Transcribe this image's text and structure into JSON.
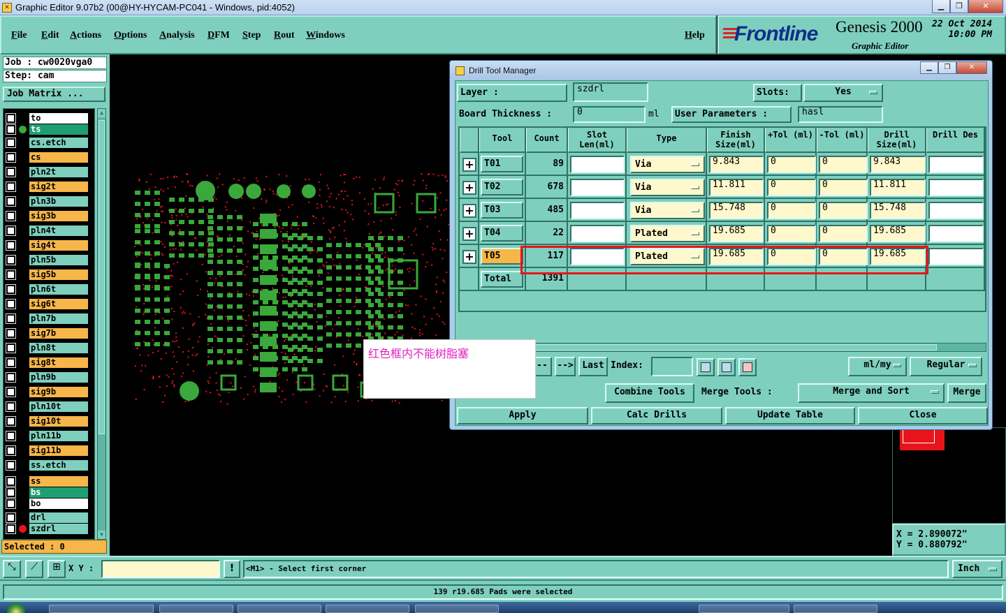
{
  "titlebar": {
    "title": "Graphic Editor 9.07b2 (00@HY-HYCAM-PC041 - Windows, pid:4052)"
  },
  "menu": [
    {
      "label": "File",
      "key": "F"
    },
    {
      "label": "Edit",
      "key": "E"
    },
    {
      "label": "Actions",
      "key": "A"
    },
    {
      "label": "Options",
      "key": "O"
    },
    {
      "label": "Analysis",
      "key": "A"
    },
    {
      "label": "DFM",
      "key": "D"
    },
    {
      "label": "Step",
      "key": "S"
    },
    {
      "label": "Rout",
      "key": "R"
    },
    {
      "label": "Windows",
      "key": "W"
    },
    {
      "label": "Help",
      "key": "H"
    }
  ],
  "brand": {
    "logo": "Frontline",
    "product": "Genesis 2000",
    "subtitle": "Graphic Editor",
    "date": "22 Oct 2014",
    "time": "10:00 PM"
  },
  "job": {
    "job_line": "Job : cw0020vga0",
    "step_line": "Step: cam",
    "matrix_label": "Job Matrix ..."
  },
  "layers": [
    {
      "name": "to",
      "color": "#ffffff",
      "dot": null
    },
    {
      "name": "ts",
      "color": "#1f9e74",
      "dot": "#3aa83a"
    },
    {
      "name": "cs.etch",
      "color": "#7fcfbe",
      "dot": null
    },
    {
      "name": "cs",
      "color": "#f6b64a",
      "dot": null
    },
    {
      "name": "pln2t",
      "color": "#7fcfbe",
      "dot": null
    },
    {
      "name": "sig2t",
      "color": "#f6b64a",
      "dot": null
    },
    {
      "name": "pln3b",
      "color": "#7fcfbe",
      "dot": null
    },
    {
      "name": "sig3b",
      "color": "#f6b64a",
      "dot": null
    },
    {
      "name": "pln4t",
      "color": "#7fcfbe",
      "dot": null
    },
    {
      "name": "sig4t",
      "color": "#f6b64a",
      "dot": null
    },
    {
      "name": "pln5b",
      "color": "#7fcfbe",
      "dot": null
    },
    {
      "name": "sig5b",
      "color": "#f6b64a",
      "dot": null
    },
    {
      "name": "pln6t",
      "color": "#7fcfbe",
      "dot": null
    },
    {
      "name": "sig6t",
      "color": "#f6b64a",
      "dot": null
    },
    {
      "name": "pln7b",
      "color": "#7fcfbe",
      "dot": null
    },
    {
      "name": "sig7b",
      "color": "#f6b64a",
      "dot": null
    },
    {
      "name": "pln8t",
      "color": "#7fcfbe",
      "dot": null
    },
    {
      "name": "sig8t",
      "color": "#f6b64a",
      "dot": null
    },
    {
      "name": "pln9b",
      "color": "#7fcfbe",
      "dot": null
    },
    {
      "name": "sig9b",
      "color": "#f6b64a",
      "dot": null
    },
    {
      "name": "pln10t",
      "color": "#7fcfbe",
      "dot": null
    },
    {
      "name": "sig10t",
      "color": "#f6b64a",
      "dot": null
    },
    {
      "name": "pln11b",
      "color": "#7fcfbe",
      "dot": null
    },
    {
      "name": "sig11b",
      "color": "#f6b64a",
      "dot": null
    },
    {
      "name": "ss.etch",
      "color": "#7fcfbe",
      "dot": null
    },
    {
      "name": "ss",
      "color": "#f6b64a",
      "dot": null
    },
    {
      "name": "bs",
      "color": "#1f9e74",
      "dot": null
    },
    {
      "name": "bo",
      "color": "#ffffff",
      "dot": null
    },
    {
      "name": "drl",
      "color": "#7fcfbe",
      "dot": null
    },
    {
      "name": "szdrl",
      "color": "#7fcfbe",
      "dot": "#e8141c"
    }
  ],
  "selected": "Selected : 0",
  "dialog": {
    "title": "Drill Tool Manager",
    "layer_label": "Layer          :",
    "layer_value": "szdrl",
    "slots_label": "Slots:",
    "slots_value": "Yes",
    "board_label": "Board Thickness :",
    "board_value": "0",
    "board_unit": "ml",
    "user_params_label": "User Parameters :",
    "user_params_value": "hasl",
    "columns": [
      "Tool",
      "Count",
      "Slot Len(ml)",
      "Type",
      "Finish Size(ml)",
      "+Tol (ml)",
      "-Tol (ml)",
      "Drill Size(ml)",
      "Drill Des"
    ],
    "rows": [
      {
        "tool": "T01",
        "count": "89",
        "type": "Via",
        "finish": "9.843",
        "ptol": "0",
        "ntol": "0",
        "drill": "9.843"
      },
      {
        "tool": "T02",
        "count": "678",
        "type": "Via",
        "finish": "11.811",
        "ptol": "0",
        "ntol": "0",
        "drill": "11.811"
      },
      {
        "tool": "T03",
        "count": "485",
        "type": "Via",
        "finish": "15.748",
        "ptol": "0",
        "ntol": "0",
        "drill": "15.748"
      },
      {
        "tool": "T04",
        "count": "22",
        "type": "Plated",
        "finish": "19.685",
        "ptol": "0",
        "ntol": "0",
        "drill": "19.685"
      },
      {
        "tool": "T05",
        "count": "117",
        "type": "Plated",
        "finish": "19.685",
        "ptol": "0",
        "ntol": "0",
        "drill": "19.685"
      }
    ],
    "total_label": "Total",
    "total_value": "1391",
    "nav": {
      "prev": "--",
      "next": "-->",
      "last": "Last",
      "index_label": "Index:",
      "units": "ml/my",
      "mode": "Regular"
    },
    "combine": "Combine Tools",
    "merge_label": "Merge Tools :",
    "merge_value": "Merge and Sort",
    "merge_btn": "Merge",
    "apply": "Apply",
    "calc": "Calc Drills",
    "update": "Update Table",
    "close": "Close"
  },
  "annotation": "红色框内不能树脂塞",
  "coords": {
    "x": "X = 2.890072\"",
    "y": "Y = 0.880792\""
  },
  "bottom": {
    "xy_label": "X Y :",
    "prompt": "<M1> - Select first corner",
    "units": "Inch",
    "status": "139 r19.685 Pads were selected"
  },
  "colors": {
    "panel": "#7fcfbe",
    "highlight": "#f6b64a",
    "pcb_green": "#3aa83a",
    "red": "#e8141c"
  }
}
